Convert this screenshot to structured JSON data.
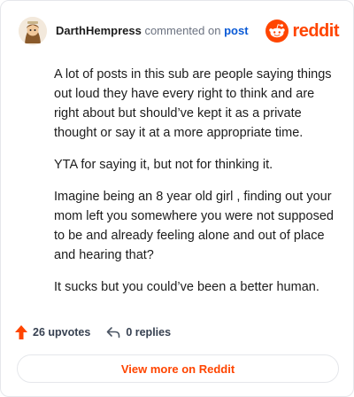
{
  "header": {
    "username": "DarthHempress",
    "verb": "commented on",
    "post_link": "post",
    "brand_name": "reddit"
  },
  "comment": {
    "paragraphs": [
      "A lot of posts in this sub are people saying things out loud they have every right to think and are right about but should’ve kept it as a private thought or say it at a more appropriate time.",
      "YTA for saying it, but not for thinking it.",
      "Imagine being an 8 year old girl , finding out your mom left you somewhere you were not supposed to be and already feeling alone and out of place and hearing that?",
      "It sucks but you could’ve been a better human."
    ]
  },
  "footer": {
    "upvotes": "26 upvotes",
    "replies": "0 replies",
    "view_more": "View more on Reddit"
  },
  "colors": {
    "brand": "#ff4500",
    "link": "#0a5ad6"
  },
  "icons": [
    "avatar",
    "reddit-logo-icon",
    "upvote-arrow-icon",
    "reply-icon"
  ]
}
